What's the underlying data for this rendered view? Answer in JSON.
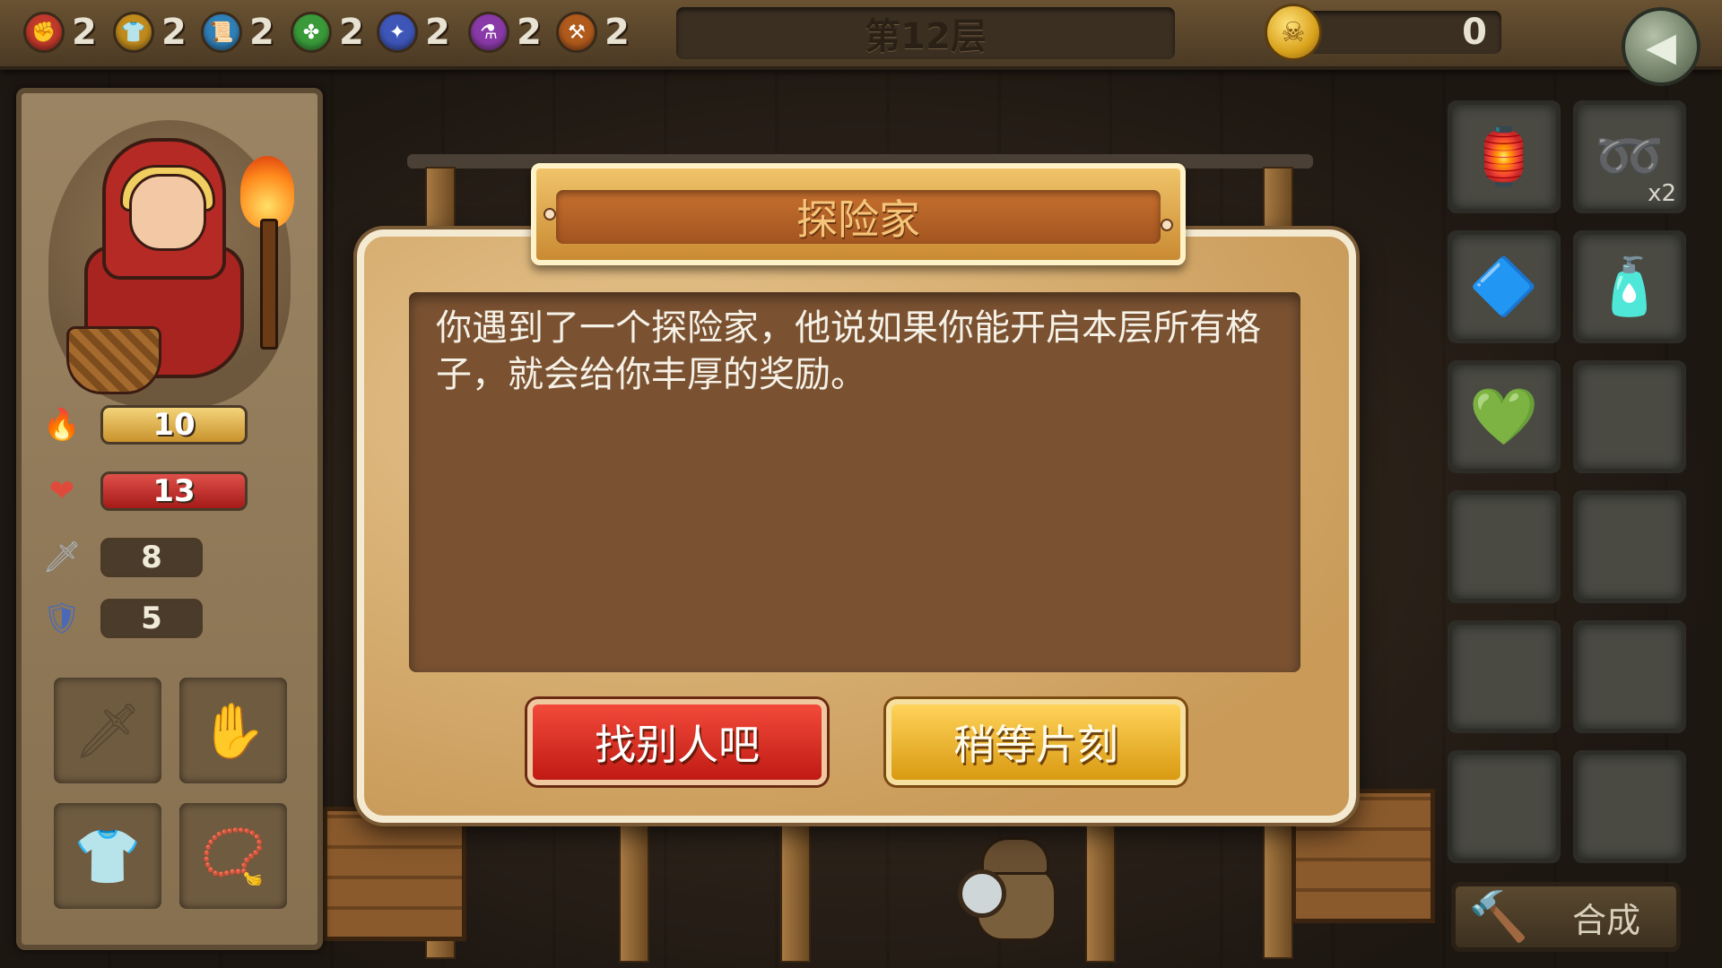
{
  "resources": [
    {
      "icon": "fist-icon",
      "glyph": "✊",
      "color": "#c0392b",
      "count": "2"
    },
    {
      "icon": "armor-icon",
      "glyph": "👕",
      "color": "#c08a1c",
      "count": "2"
    },
    {
      "icon": "scroll-icon",
      "glyph": "📜",
      "color": "#2f7fb8",
      "count": "2"
    },
    {
      "icon": "clover-icon",
      "glyph": "✤",
      "color": "#3a9a3a",
      "count": "2"
    },
    {
      "icon": "star-icon",
      "glyph": "✦",
      "color": "#3e56b8",
      "count": "2"
    },
    {
      "icon": "potion-icon",
      "glyph": "⚗",
      "color": "#8a3aa8",
      "count": "2"
    },
    {
      "icon": "anvil-icon",
      "glyph": "⚒",
      "color": "#b05a1c",
      "count": "2"
    }
  ],
  "floor": {
    "label": "第12层"
  },
  "coins": {
    "value": "0"
  },
  "stats": {
    "attack": "10",
    "health": "13",
    "sword": "8",
    "shield": "5"
  },
  "inventory": [
    {
      "icon": "lantern-icon",
      "glyph": "🏮",
      "count": ""
    },
    {
      "icon": "rope-icon",
      "glyph": "➿",
      "count": "x2"
    },
    {
      "icon": "blue-gem-icon",
      "glyph": "🔷",
      "count": ""
    },
    {
      "icon": "bottle-icon",
      "glyph": "🧴",
      "count": ""
    },
    {
      "icon": "green-gem-icon",
      "glyph": "💚",
      "count": ""
    },
    {
      "icon": "",
      "glyph": "",
      "count": ""
    },
    {
      "icon": "",
      "glyph": "",
      "count": ""
    },
    {
      "icon": "",
      "glyph": "",
      "count": ""
    },
    {
      "icon": "",
      "glyph": "",
      "count": ""
    },
    {
      "icon": "",
      "glyph": "",
      "count": ""
    },
    {
      "icon": "",
      "glyph": "",
      "count": ""
    },
    {
      "icon": "",
      "glyph": "",
      "count": ""
    }
  ],
  "craft": {
    "label": "合成"
  },
  "dialog": {
    "title": "探险家",
    "message": "你遇到了一个探险家，他说如果你能开启本层所有格子，就会给你丰厚的奖励。",
    "decline": "找别人吧",
    "wait": "稍等片刻"
  }
}
